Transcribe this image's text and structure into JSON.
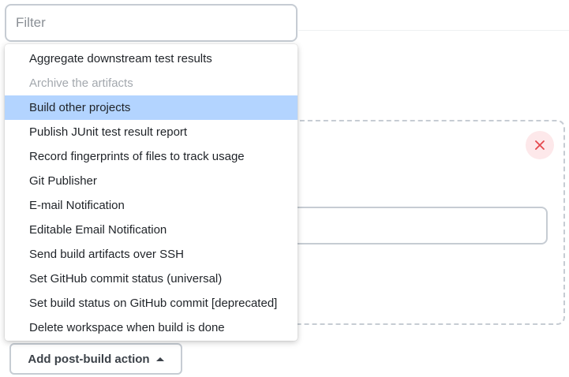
{
  "filter": {
    "placeholder": "Filter",
    "value": ""
  },
  "menu": {
    "items": [
      {
        "label": "Aggregate downstream test results",
        "state": "normal"
      },
      {
        "label": "Archive the artifacts",
        "state": "disabled"
      },
      {
        "label": "Build other projects",
        "state": "selected"
      },
      {
        "label": "Publish JUnit test result report",
        "state": "normal"
      },
      {
        "label": "Record fingerprints of files to track usage",
        "state": "normal"
      },
      {
        "label": "Git Publisher",
        "state": "normal"
      },
      {
        "label": "E-mail Notification",
        "state": "normal"
      },
      {
        "label": "Editable Email Notification",
        "state": "normal"
      },
      {
        "label": "Send build artifacts over SSH",
        "state": "normal"
      },
      {
        "label": "Set GitHub commit status (universal)",
        "state": "normal"
      },
      {
        "label": "Set build status on GitHub commit [deprecated]",
        "state": "normal"
      },
      {
        "label": "Delete workspace when build is done",
        "state": "normal"
      }
    ]
  },
  "add_button": {
    "label": "Add post-build action",
    "icon": "caret-up-icon"
  },
  "close_button": {
    "icon": "close-icon"
  },
  "colors": {
    "selected_bg": "#b3d4ff",
    "close_red": "#e5484d",
    "border": "#c6ccd3"
  }
}
